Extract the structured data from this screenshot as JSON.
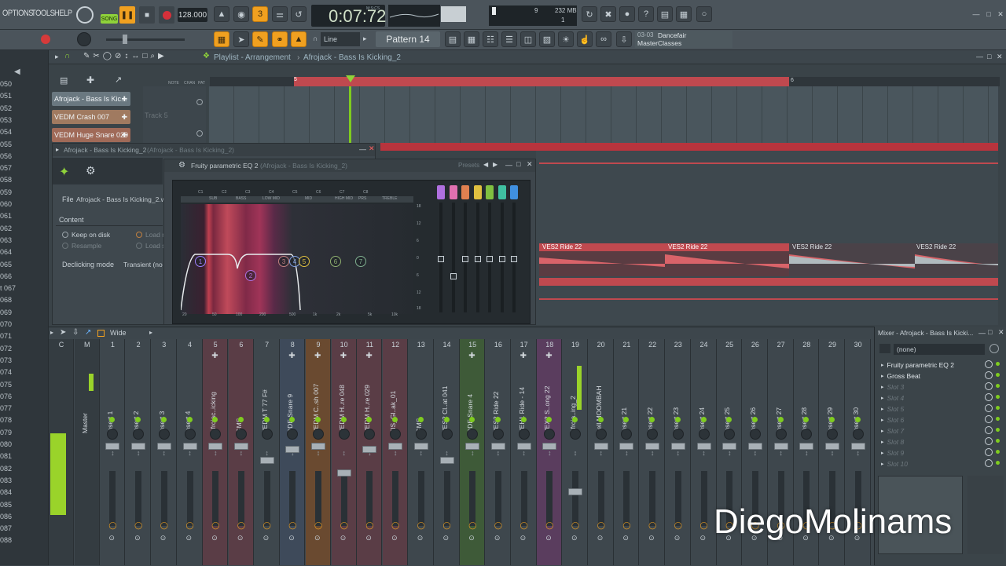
{
  "menu": {
    "options": "OPTIONS",
    "tools": "TOOLS",
    "help": "HELP"
  },
  "transport": {
    "song_mode": "SONG",
    "tempo": "128.000",
    "time": "0:07:72",
    "time_unit": "M:S:CS",
    "cpu_value": "9",
    "memory": "232 MB",
    "poly": "1",
    "line_mode": "Line",
    "pattern": "Pattern 14"
  },
  "hint": {
    "date": "03-03",
    "title": "Dancefair",
    "subtitle": "MasterClasses"
  },
  "playlist": {
    "title": "Playlist - Arrangement",
    "breadcrumb": "Afrojack - Bass Is Kicking_2",
    "track_label": "Track 5",
    "marker5": "5",
    "marker6": "6",
    "note_labels": [
      "NOTE",
      "CHAN",
      "PAT"
    ]
  },
  "channel_buttons": [
    "Afrojack - Bass Is Kic...",
    "VEDM Crash 007",
    "VEDM Huge Snare 029"
  ],
  "row_numbers": [
    "050",
    "051",
    "052",
    "053",
    "054",
    "055",
    "056",
    "057",
    "058",
    "059",
    "060",
    "061",
    "062",
    "063",
    "064",
    "065",
    "066",
    "t 067",
    "068",
    "069",
    "070",
    "071",
    "072",
    "073",
    "074",
    "075",
    "076",
    "077",
    "078",
    "079",
    "080",
    "081",
    "082",
    "083",
    "084",
    "085",
    "086",
    "087",
    "088"
  ],
  "channel_window": {
    "title": "Afrojack - Bass Is Kicking_2",
    "title_sub": "(Afrojack - Bass Is Kicking_2)",
    "file_label": "File",
    "file_value": "Afrojack - Bass Is Kicking_2.wa",
    "content_label": "Content",
    "keep_on_disk": "Keep on disk",
    "resample": "Resample",
    "load1": "Load r",
    "load2": "Load s",
    "declicking_label": "Declicking mode",
    "declicking_value": "Transient (no"
  },
  "eq_window": {
    "title": "Fruity parametric EQ 2",
    "title_sub": "(Afrojack - Bass Is Kicking_2)",
    "presets": "Presets",
    "notes": [
      "C1",
      "C2",
      "C3",
      "C4",
      "C5",
      "C6",
      "C7",
      "C8"
    ],
    "bands": [
      "SUB",
      "BASS",
      "LOW MID",
      "MID",
      "HIGH MID",
      "PRS",
      "TREBLE"
    ],
    "db_labels": [
      "18",
      "12",
      "6",
      "0",
      "6",
      "12",
      "18"
    ],
    "freq_labels": [
      "20",
      "50",
      "100",
      "200",
      "500",
      "1k",
      "2k",
      "5k",
      "10k"
    ],
    "nodes": [
      "1",
      "2",
      "3",
      "4",
      "5",
      "6",
      "7"
    ]
  },
  "clips": [
    {
      "label": "VES2 Ride 22"
    },
    {
      "label": "VES2 Ride 22"
    },
    {
      "label": "VES2 Ride 22"
    },
    {
      "label": "VES2 Ride 22"
    }
  ],
  "mixer_toolbar": {
    "wide": "Wide"
  },
  "mixer": {
    "strips": [
      {
        "num": "C",
        "name": ""
      },
      {
        "num": "M",
        "name": "Master"
      },
      {
        "num": "1",
        "name": "Insert 1"
      },
      {
        "num": "2",
        "name": "Insert 2"
      },
      {
        "num": "3",
        "name": "Insert 3"
      },
      {
        "num": "4",
        "name": "Insert 4"
      },
      {
        "num": "5",
        "name": "Afrojac..icking"
      },
      {
        "num": "6",
        "name": "GMS"
      },
      {
        "num": "7",
        "name": "VEDM T 77 F#"
      },
      {
        "num": "8",
        "name": "DDE Snare 9"
      },
      {
        "num": "9",
        "name": "VEDM C..sh 007"
      },
      {
        "num": "10",
        "name": "VEDM H..re 048"
      },
      {
        "num": "11",
        "name": "VEDM H..re 029"
      },
      {
        "num": "12",
        "name": "FIS_Gl..ak_01"
      },
      {
        "num": "13",
        "name": "GMS"
      },
      {
        "num": "14",
        "name": "VES2 Cl..at 041"
      },
      {
        "num": "15",
        "name": "DDE Snare 4"
      },
      {
        "num": "16",
        "name": "VES2 Ride 22"
      },
      {
        "num": "17",
        "name": "VEH1 Ride - 14"
      },
      {
        "num": "18",
        "name": "VEX2 S..ong 22"
      },
      {
        "num": "19",
        "name": "Afroja..ing_2"
      },
      {
        "num": "20",
        "name": "bell MOOMBAH"
      },
      {
        "num": "21",
        "name": "Insert 21"
      },
      {
        "num": "22",
        "name": "Insert 22"
      },
      {
        "num": "23",
        "name": "Insert 23"
      },
      {
        "num": "24",
        "name": "Insert 24"
      },
      {
        "num": "25",
        "name": "Insert 25"
      },
      {
        "num": "26",
        "name": "Insert 26"
      },
      {
        "num": "27",
        "name": "Insert 27"
      },
      {
        "num": "28",
        "name": "Insert 28"
      },
      {
        "num": "29",
        "name": "Insert 29"
      },
      {
        "num": "30",
        "name": "Insert 30"
      }
    ]
  },
  "mixer_side": {
    "title": "Mixer - Afrojack - Bass Is Kicki...",
    "preset": "(none)",
    "slots": [
      "Fruity parametric EQ 2",
      "Gross Beat",
      "Slot 3",
      "Slot 4",
      "Slot 5",
      "Slot 6",
      "Slot 7",
      "Slot 8",
      "Slot 9",
      "Slot 10"
    ]
  },
  "watermark": "DiegoMolinams",
  "colors": {
    "accent": "#f0a020",
    "clip_red": "#c0494f",
    "led_green": "#7fcc1f"
  }
}
